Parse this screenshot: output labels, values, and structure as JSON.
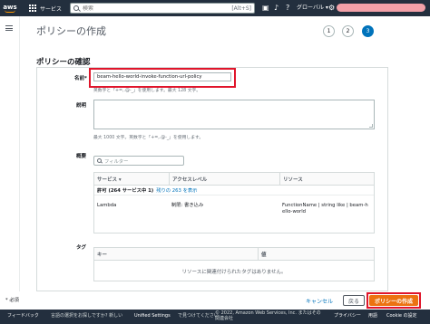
{
  "topnav": {
    "logo": "aws",
    "services_label": "サービス",
    "search_placeholder": "検索",
    "search_shortcut": "[Alt+S]",
    "region_label": "グローバル ▾",
    "icons": [
      "grid-icon",
      "search-icon",
      "cloudshell-icon",
      "bell-icon",
      "help-icon",
      "gear-icon"
    ]
  },
  "page": {
    "title": "ポリシーの作成",
    "steps": [
      "1",
      "2",
      "3"
    ],
    "active_step": "3"
  },
  "review": {
    "section_title": "ポリシーの確認",
    "name_label": "名前*",
    "name_value": "beam-hello-world-invoke-function-url-policy",
    "name_hint": "英数字と「+=,.@-_」を使用します。最大 128 文字。",
    "description_label": "説明",
    "description_value": "",
    "description_hint": "最大 1000 文字。英数字と「+=,.@-_」を使用します。",
    "summary_label": "概要",
    "filter_placeholder": "フィルター",
    "summary_columns": [
      "サービス ▾",
      "アクセスレベル",
      "リソース"
    ],
    "group_row_prefix": "許可 (264 サービス中 1)",
    "group_row_link": "残りの 263 を表示",
    "rows": [
      {
        "service": "Lambda",
        "access": "制限: 書き込み",
        "resource": "FunctionName | string like | beam-hello-world"
      }
    ],
    "tags_label": "タグ",
    "tags_columns": [
      "キー",
      "値"
    ],
    "tags_empty": "リソースに関連付けられたタグはありません。"
  },
  "actions": {
    "required_note": "* 必須",
    "cancel": "キャンセル",
    "back": "戻る",
    "create": "ポリシーの作成"
  },
  "footer": {
    "feedback": "フィードバック",
    "language_text": "言語の選択をお探しですか? 新しい",
    "unified_settings": "Unified Settings",
    "unified_suffix": "で見つけてください",
    "copyright": "© 2022, Amazon Web Services, Inc. またはその関連会社",
    "privacy": "プライバシー",
    "terms": "用語",
    "cookie": "Cookie の設定"
  },
  "colors": {
    "nav_bg": "#232f3e",
    "accent": "#0073bb",
    "primary_button": "#ec7211",
    "highlight": "#e0152b"
  }
}
